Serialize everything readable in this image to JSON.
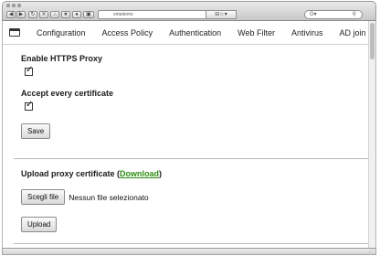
{
  "browser": {
    "address_text": "vmsdemo",
    "go_label": "⊟☆▾",
    "search_glass": "G▾",
    "search_magnifier": "🔍"
  },
  "menu": {
    "items": [
      {
        "label": "Configuration"
      },
      {
        "label": "Access Policy"
      },
      {
        "label": "Authentication"
      },
      {
        "label": "Web Filter"
      },
      {
        "label": "Antivirus"
      },
      {
        "label": "AD join"
      }
    ]
  },
  "https_proxy": {
    "enable_label": "Enable HTTPS Proxy",
    "enable_checked": true,
    "accept_label": "Accept every certificate",
    "accept_checked": true,
    "save_label": "Save",
    "check_glyph": "✓"
  },
  "upload": {
    "title": "Upload proxy certificate",
    "paren_open": "(",
    "download_link": "Download",
    "paren_close": ")",
    "choose_file_label": "Scegli file",
    "file_status": "Nessun file selezionato",
    "upload_label": "Upload"
  },
  "colors": {
    "link": "#2c8b12",
    "divider": "#b9b9b9"
  }
}
